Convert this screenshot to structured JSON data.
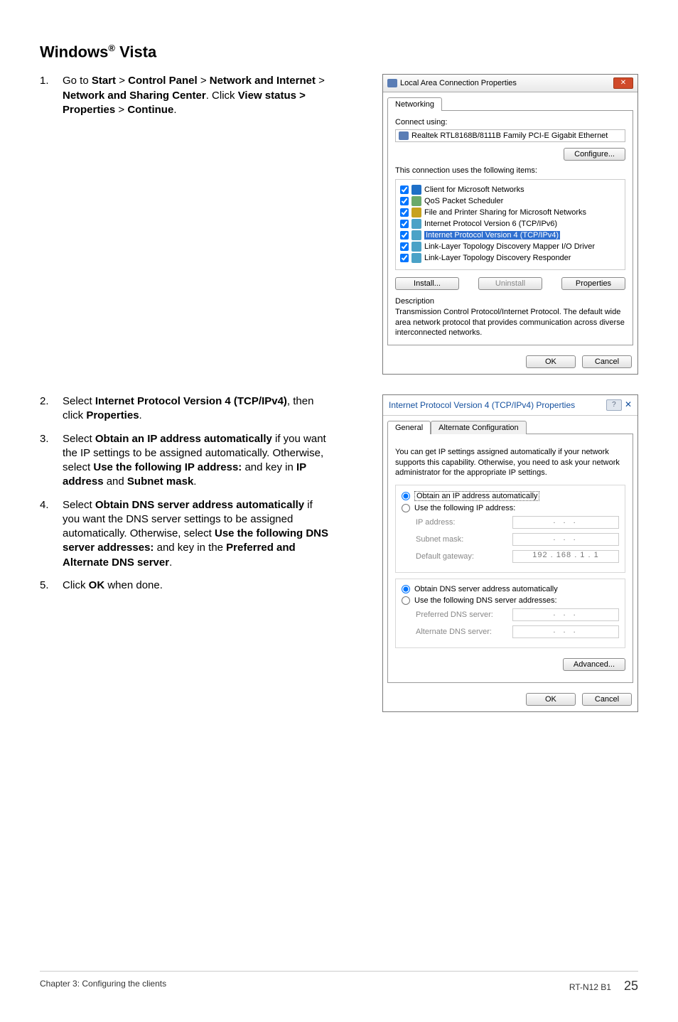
{
  "heading_prefix": "Windows",
  "heading_suffix": " Vista",
  "heading_reg": "®",
  "steps": {
    "s1_a": "Go to ",
    "s1_b": "Start",
    "s1_c": " > ",
    "s1_d": "Control Panel",
    "s1_e": " > ",
    "s1_f": "Network and Internet",
    "s1_g": " > ",
    "s1_h": "Network and Sharing Center",
    "s1_i": ". Click ",
    "s1_j": "View status > Properties",
    "s1_k": " > ",
    "s1_l": "Continue",
    "s1_m": ".",
    "s2_a": "Select ",
    "s2_b": "Internet Protocol Version 4 (TCP/IPv4)",
    "s2_c": ", then click ",
    "s2_d": "Properties",
    "s2_e": ".",
    "s3_a": "Select ",
    "s3_b": "Obtain an IP address automatically",
    "s3_c": " if you want the IP settings to be assigned automatically. Otherwise, select ",
    "s3_d": "Use the following IP address:",
    "s3_e": " and key in ",
    "s3_f": "IP address",
    "s3_g": " and ",
    "s3_h": "Subnet mask",
    "s3_i": ".",
    "s4_a": "Select ",
    "s4_b": "Obtain DNS server address automatically",
    "s4_c": " if you want the DNS server settings to be assigned automatically. Otherwise, select ",
    "s4_d": "Use the following DNS server addresses:",
    "s4_e": " and key in the ",
    "s4_f": "Preferred and Alternate DNS server",
    "s4_g": ".",
    "s5_a": "Click ",
    "s5_b": "OK",
    "s5_c": " when done."
  },
  "dlg1": {
    "title": "Local Area Connection Properties",
    "tab": "Networking",
    "connect_using": "Connect using:",
    "adapter": "Realtek RTL8168B/8111B Family PCI-E Gigabit Ethernet",
    "configure": "Configure...",
    "uses": "This connection uses the following items:",
    "items": [
      "Client for Microsoft Networks",
      "QoS Packet Scheduler",
      "File and Printer Sharing for Microsoft Networks",
      "Internet Protocol Version 6 (TCP/IPv6)",
      "Internet Protocol Version 4 (TCP/IPv4)",
      "Link-Layer Topology Discovery Mapper I/O Driver",
      "Link-Layer Topology Discovery Responder"
    ],
    "install": "Install...",
    "uninstall": "Uninstall",
    "properties": "Properties",
    "desc_label": "Description",
    "desc": "Transmission Control Protocol/Internet Protocol. The default wide area network protocol that provides communication across diverse interconnected networks.",
    "ok": "OK",
    "cancel": "Cancel"
  },
  "dlg2": {
    "title": "Internet Protocol Version 4 (TCP/IPv4) Properties",
    "tab_general": "General",
    "tab_alt": "Alternate Configuration",
    "desc": "You can get IP settings assigned automatically if your network supports this capability. Otherwise, you need to ask your network administrator for the appropriate IP settings.",
    "r_auto_ip": "Obtain an IP address automatically",
    "r_use_ip": "Use the following IP address:",
    "ip_addr": "IP address:",
    "subnet": "Subnet mask:",
    "gateway": "Default gateway:",
    "gateway_val": "192 . 168 .  1  .  1",
    "dots": ".       .       .",
    "r_auto_dns": "Obtain DNS server address automatically",
    "r_use_dns": "Use the following DNS server addresses:",
    "pref_dns": "Preferred DNS server:",
    "alt_dns": "Alternate DNS server:",
    "advanced": "Advanced...",
    "ok": "OK",
    "cancel": "Cancel"
  },
  "footer": {
    "left": "Chapter 3: Configuring the clients",
    "model": "RT-N12 B1",
    "page": "25"
  }
}
